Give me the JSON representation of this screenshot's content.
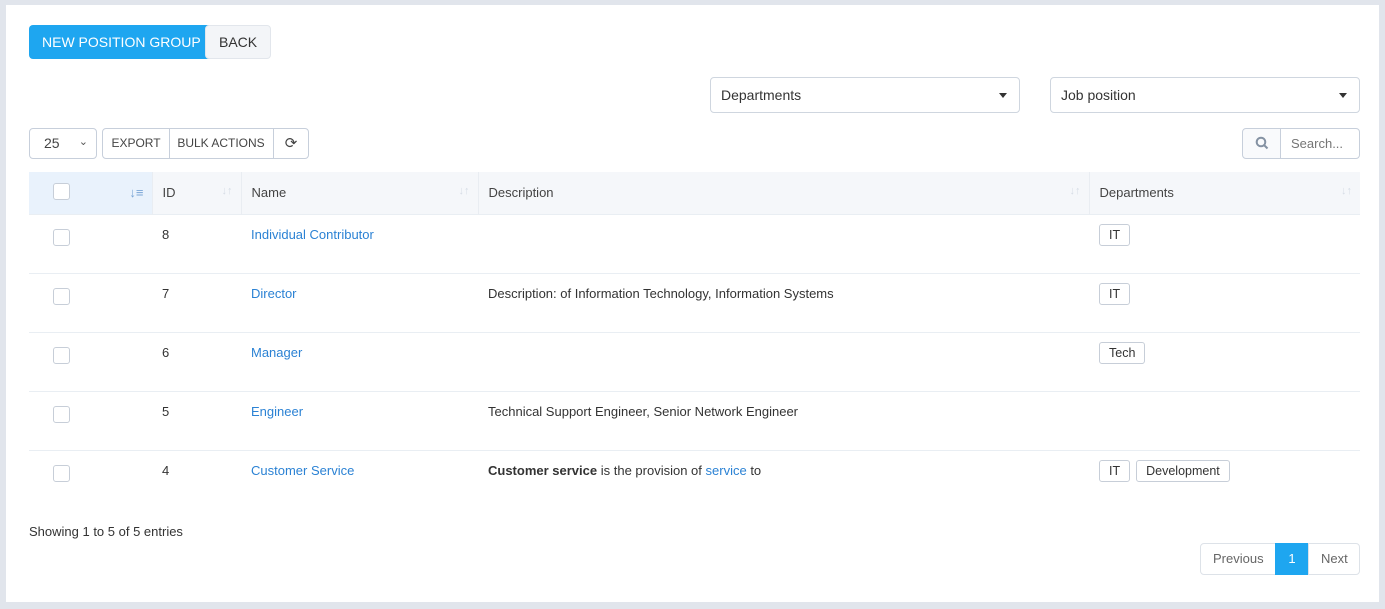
{
  "toolbar": {
    "new_label": "NEW POSITION GROUP",
    "back_label": "BACK"
  },
  "filters": {
    "departments": "Departments",
    "job_position": "Job position"
  },
  "controls": {
    "page_size": "25",
    "export": "EXPORT",
    "bulk": "BULK ACTIONS",
    "search_placeholder": "Search..."
  },
  "columns": [
    "ID",
    "Name",
    "Description",
    "Departments"
  ],
  "rows": [
    {
      "id": "8",
      "name": "Individual Contributor",
      "desc": "",
      "desc_bold": "",
      "desc_link": "",
      "desc_tail": "",
      "depts": [
        "IT"
      ]
    },
    {
      "id": "7",
      "name": "Director",
      "desc": "Description: of Information Technology, Information Systems",
      "desc_bold": "",
      "desc_link": "",
      "desc_tail": "",
      "depts": [
        "IT"
      ]
    },
    {
      "id": "6",
      "name": "Manager",
      "desc": "",
      "desc_bold": "",
      "desc_link": "",
      "desc_tail": "",
      "depts": [
        "Tech"
      ]
    },
    {
      "id": "5",
      "name": "Engineer",
      "desc": "Technical Support Engineer, Senior Network Engineer",
      "desc_bold": "",
      "desc_link": "",
      "desc_tail": "",
      "depts": []
    },
    {
      "id": "4",
      "name": "Customer Service",
      "desc": "",
      "desc_bold": "Customer service",
      "desc_mid": " is the provision of ",
      "desc_link": "service",
      "desc_tail": " to",
      "depts": [
        "IT",
        "Development"
      ]
    }
  ],
  "footer": {
    "info": "Showing 1 to 5 of 5 entries",
    "prev": "Previous",
    "page": "1",
    "next": "Next"
  },
  "colors": {
    "primary": "#1ea6f0",
    "link": "#2b82d4"
  }
}
